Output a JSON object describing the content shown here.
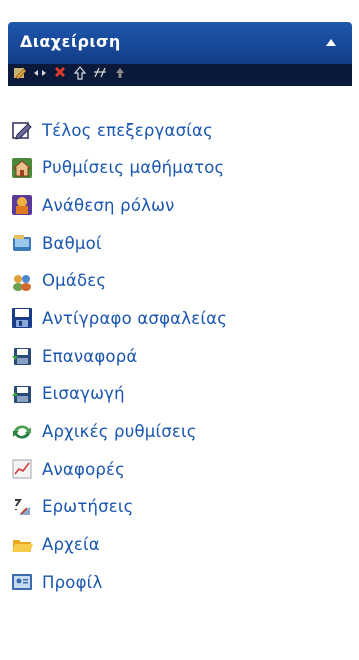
{
  "block": {
    "title": "Διαχείριση",
    "collapse_icon": "caret-up-icon"
  },
  "toolbar": {
    "buttons": [
      "edit-icon",
      "move-icon",
      "delete-icon",
      "move-up-icon",
      "show-hide-icon",
      "move-down-icon"
    ]
  },
  "menu": {
    "items": [
      {
        "label": "Τέλος επεξεργασίας",
        "icon": "edit-icon"
      },
      {
        "label": "Ρυθμίσεις μαθήματος",
        "icon": "course-settings-icon"
      },
      {
        "label": "Ανάθεση ρόλων",
        "icon": "roles-icon"
      },
      {
        "label": "Βαθμοί",
        "icon": "grades-icon"
      },
      {
        "label": "Ομάδες",
        "icon": "groups-icon"
      },
      {
        "label": "Αντίγραφο ασφαλείας",
        "icon": "backup-icon"
      },
      {
        "label": "Επαναφορά",
        "icon": "restore-icon"
      },
      {
        "label": "Εισαγωγή",
        "icon": "import-icon"
      },
      {
        "label": "Αρχικές ρυθμίσεις",
        "icon": "reset-icon"
      },
      {
        "label": "Αναφορές",
        "icon": "reports-icon"
      },
      {
        "label": "Ερωτήσεις",
        "icon": "questions-icon"
      },
      {
        "label": "Αρχεία",
        "icon": "files-icon"
      },
      {
        "label": "Προφίλ",
        "icon": "profile-icon"
      }
    ]
  },
  "colors": {
    "header": "#1a4c9e",
    "toolbar": "#0b1a3a",
    "link": "#1a56b0"
  }
}
